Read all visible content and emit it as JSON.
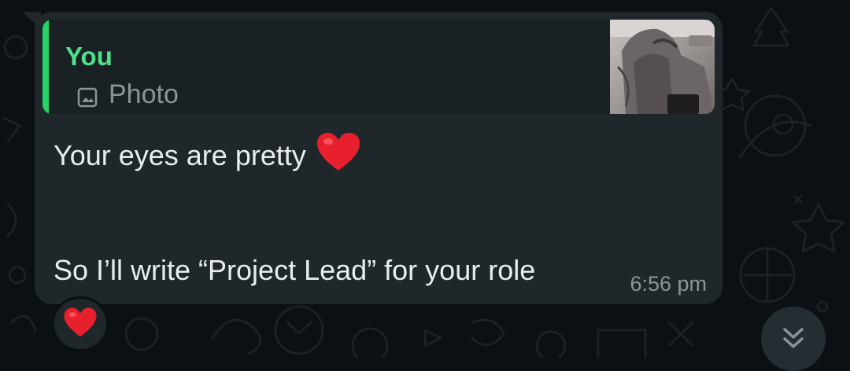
{
  "quoted_message": {
    "sender": "You",
    "type_label": "Photo",
    "type_icon": "image-icon",
    "thumbnail": "photo-thumbnail"
  },
  "message": {
    "line1": "Your eyes are pretty",
    "line1_emoji": "red-heart-emoji",
    "line2": "So I’ll write “Project Lead” for your role",
    "time": "6:56 pm"
  },
  "reaction": {
    "emoji": "red-heart-emoji"
  },
  "scroll_button": {
    "icon": "double-chevron-down-icon"
  },
  "colors": {
    "background": "#0b1014",
    "bubble": "#1f272a",
    "quote_bg": "#1a2124",
    "accent_green": "#25d366",
    "sender_green": "#4fe08c",
    "text": "#e9edef",
    "muted": "#8b9599",
    "heart_red": "#e8202e"
  }
}
